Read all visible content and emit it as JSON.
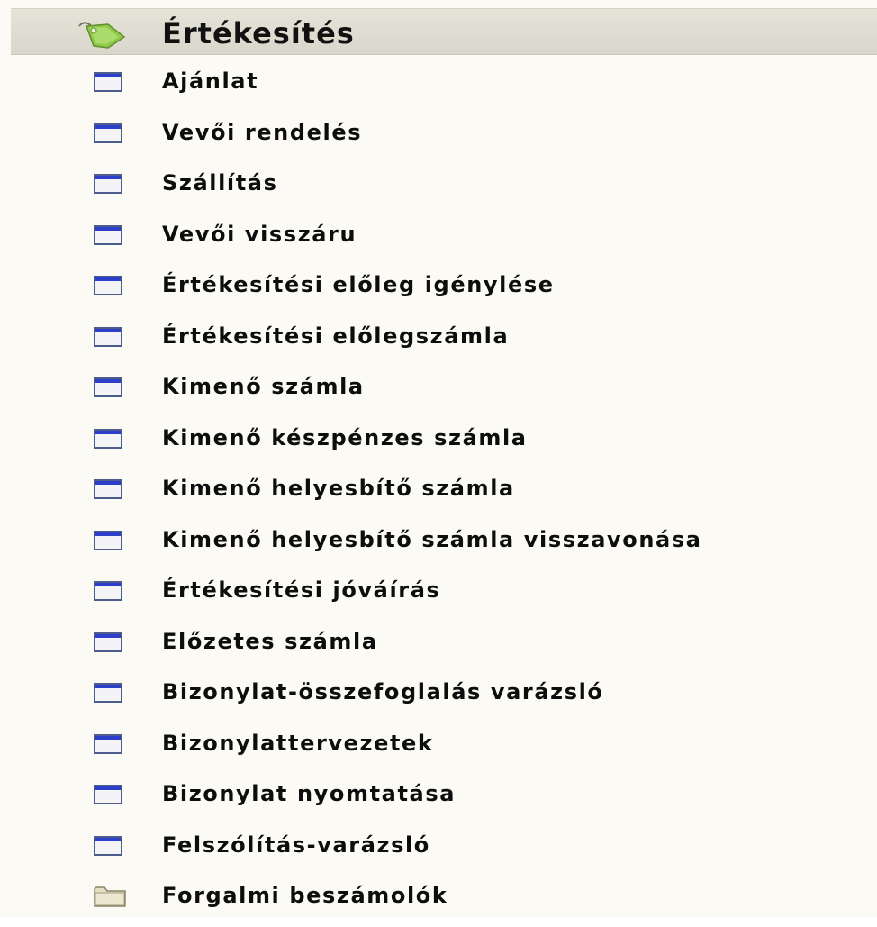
{
  "header": {
    "title": "Értékesítés",
    "icon": "price-tag-icon"
  },
  "colors": {
    "header_bg": "#ddd9ce",
    "window_icon_border": "#4c5c8c",
    "window_icon_title": "#2d3fc8",
    "folder": "#e4dfc4",
    "tag_green": "#8fc94a"
  },
  "items": [
    {
      "label": "Ajánlat",
      "icon": "window-icon"
    },
    {
      "label": "Vevői rendelés",
      "icon": "window-icon"
    },
    {
      "label": "Szállítás",
      "icon": "window-icon"
    },
    {
      "label": "Vevői visszáru",
      "icon": "window-icon"
    },
    {
      "label": "Értékesítési előleg igénylése",
      "icon": "window-icon"
    },
    {
      "label": "Értékesítési előlegszámla",
      "icon": "window-icon"
    },
    {
      "label": "Kimenő számla",
      "icon": "window-icon"
    },
    {
      "label": "Kimenő készpénzes számla",
      "icon": "window-icon"
    },
    {
      "label": "Kimenő helyesbítő számla",
      "icon": "window-icon"
    },
    {
      "label": "Kimenő helyesbítő számla visszavonása",
      "icon": "window-icon"
    },
    {
      "label": "Értékesítési jóváírás",
      "icon": "window-icon"
    },
    {
      "label": "Előzetes számla",
      "icon": "window-icon"
    },
    {
      "label": "Bizonylat-összefoglalás varázsló",
      "icon": "window-icon"
    },
    {
      "label": "Bizonylattervezetek",
      "icon": "window-icon"
    },
    {
      "label": "Bizonylat nyomtatása",
      "icon": "window-icon"
    },
    {
      "label": "Felszólítás-varázsló",
      "icon": "window-icon"
    },
    {
      "label": "Forgalmi beszámolók",
      "icon": "folder-icon"
    }
  ]
}
